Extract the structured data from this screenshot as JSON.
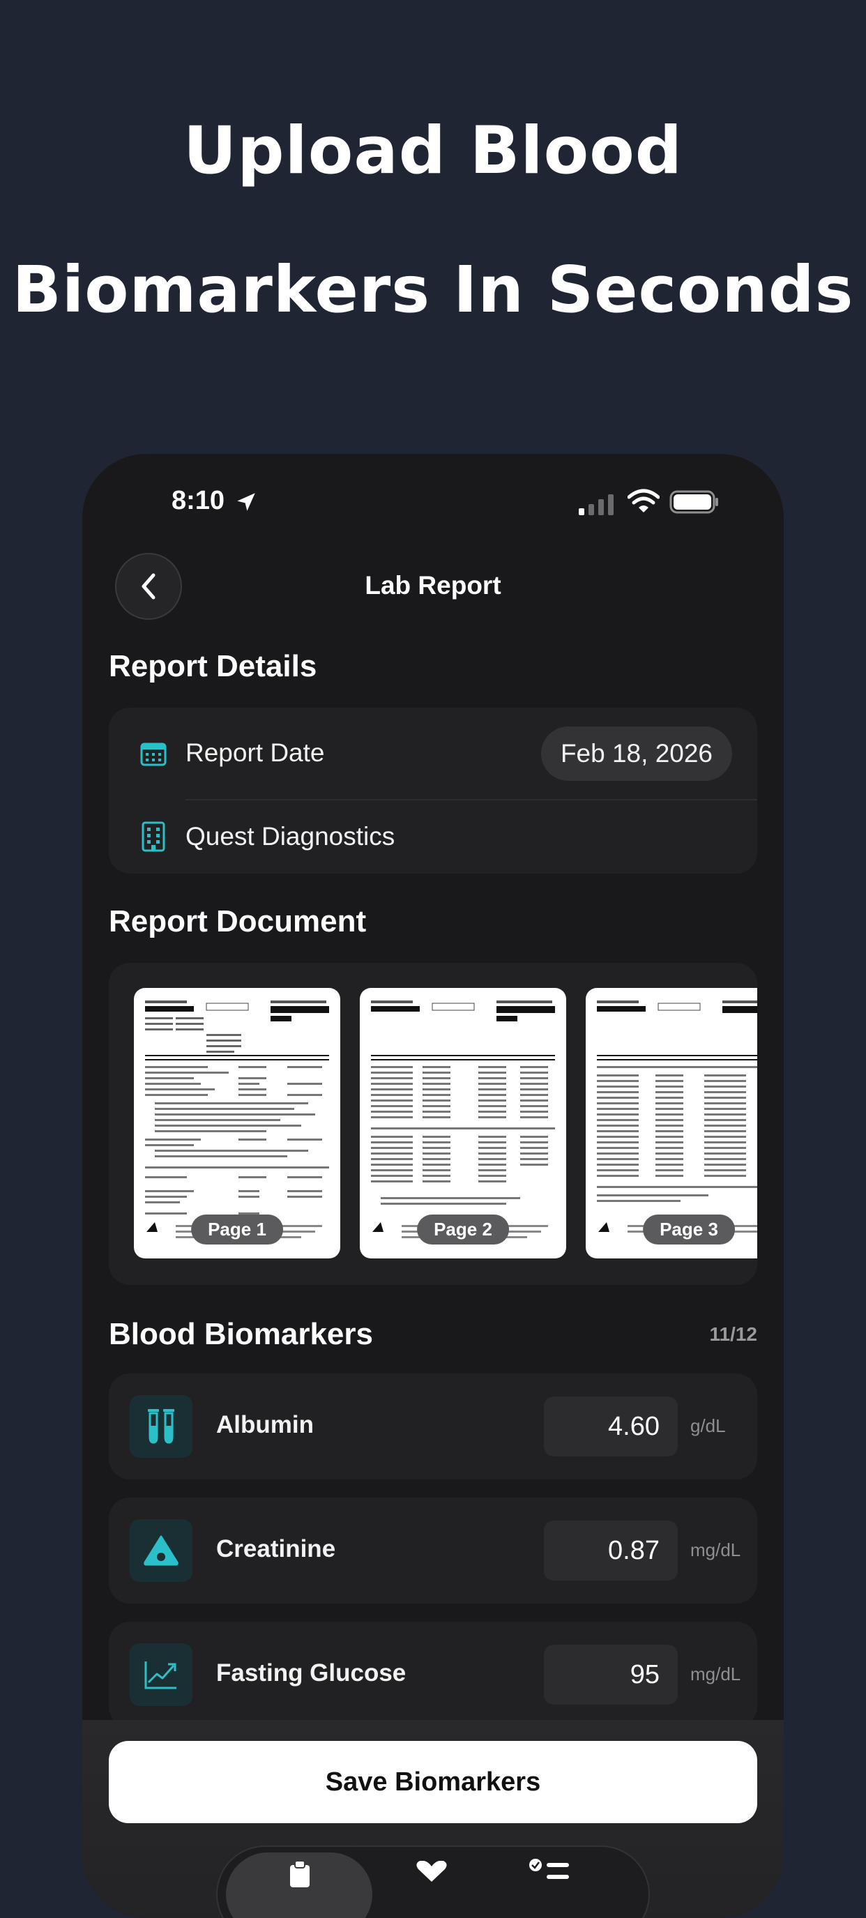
{
  "headline": {
    "line1": "Upload Blood",
    "line2": "Biomarkers In Seconds"
  },
  "status_bar": {
    "time": "8:10"
  },
  "nav": {
    "title": "Lab Report"
  },
  "report_details": {
    "title": "Report Details",
    "date_label": "Report Date",
    "date_value": "Feb 18, 2026",
    "provider": "Quest Diagnostics"
  },
  "report_document": {
    "title": "Report Document",
    "pages": [
      {
        "label": "Page 1"
      },
      {
        "label": "Page 2"
      },
      {
        "label": "Page 3"
      }
    ]
  },
  "biomarkers": {
    "title": "Blood Biomarkers",
    "count": "11/12",
    "items": [
      {
        "name": "Albumin",
        "value": "4.60",
        "unit": "g/dL",
        "icon": "test-tubes-icon"
      },
      {
        "name": "Creatinine",
        "value": "0.87",
        "unit": "mg/dL",
        "icon": "drop-icon"
      },
      {
        "name": "Fasting Glucose",
        "value": "95",
        "unit": "mg/dL",
        "icon": "trend-chart-icon"
      }
    ]
  },
  "actions": {
    "save_label": "Save Biomarkers"
  },
  "colors": {
    "accent": "#2bc0c8",
    "background": "#1f2533",
    "phone_bg": "#19191b"
  }
}
